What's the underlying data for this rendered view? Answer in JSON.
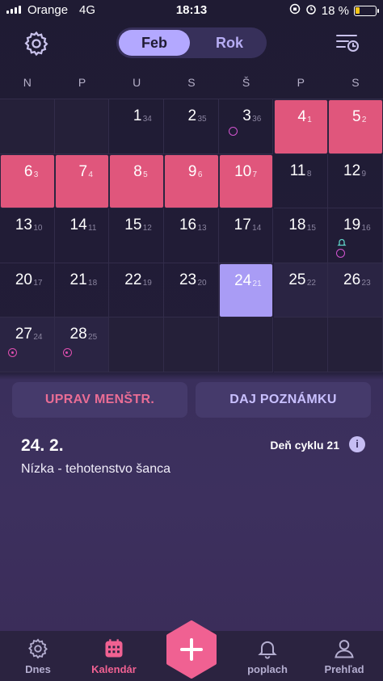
{
  "status_bar": {
    "carrier": "Orange",
    "network": "4G",
    "time": "18:13",
    "battery": "18 %"
  },
  "header": {
    "toggle_active": "Feb",
    "toggle_inactive": "Rok",
    "icons": {
      "left": "gear-icon",
      "right": "filter-clock-icon"
    }
  },
  "weekdays": [
    "N",
    "P",
    "U",
    "S",
    "Š",
    "P",
    "S"
  ],
  "calendar": {
    "row1": [
      {
        "day": "",
        "cycle": ""
      },
      {
        "day": "",
        "cycle": ""
      },
      {
        "day": "1",
        "cycle": "34"
      },
      {
        "day": "2",
        "cycle": "35"
      },
      {
        "day": "3",
        "cycle": "36"
      },
      {
        "day": "4",
        "cycle": "1"
      },
      {
        "day": "5",
        "cycle": "2"
      }
    ],
    "row2": [
      {
        "day": "6",
        "cycle": "3"
      },
      {
        "day": "7",
        "cycle": "4"
      },
      {
        "day": "8",
        "cycle": "5"
      },
      {
        "day": "9",
        "cycle": "6"
      },
      {
        "day": "10",
        "cycle": "7"
      },
      {
        "day": "11",
        "cycle": "8"
      },
      {
        "day": "12",
        "cycle": "9"
      }
    ],
    "row3": [
      {
        "day": "13",
        "cycle": "10"
      },
      {
        "day": "14",
        "cycle": "11"
      },
      {
        "day": "15",
        "cycle": "12"
      },
      {
        "day": "16",
        "cycle": "13"
      },
      {
        "day": "17",
        "cycle": "14"
      },
      {
        "day": "18",
        "cycle": "15"
      },
      {
        "day": "19",
        "cycle": "16"
      }
    ],
    "row4": [
      {
        "day": "20",
        "cycle": "17"
      },
      {
        "day": "21",
        "cycle": "18"
      },
      {
        "day": "22",
        "cycle": "19"
      },
      {
        "day": "23",
        "cycle": "20"
      },
      {
        "day": "24",
        "cycle": "21"
      },
      {
        "day": "25",
        "cycle": "22"
      },
      {
        "day": "26",
        "cycle": "23"
      }
    ],
    "row5": [
      {
        "day": "27",
        "cycle": "24"
      },
      {
        "day": "28",
        "cycle": "25"
      }
    ],
    "period_days": [
      "4",
      "5",
      "6",
      "7",
      "8",
      "9",
      "10"
    ],
    "selected_day": "24",
    "colors": {
      "period": "#e0567c",
      "selected": "#a99cf5",
      "background": "#1f1b33"
    }
  },
  "actions": {
    "edit_period": "UPRAV MENŠTR.",
    "add_note": "DAJ POZNÁMKU"
  },
  "day_detail": {
    "date": "24. 2.",
    "cycle_day": "Deň cyklu 21",
    "info_icon": "i",
    "fertility": "Nízka - tehotenstvo šanca"
  },
  "tabbar": {
    "today": "Dnes",
    "calendar": "Kalendár",
    "alarm": "poplach",
    "overview": "Prehľad",
    "add_icon": "plus-icon",
    "active_color": "#f06192"
  }
}
